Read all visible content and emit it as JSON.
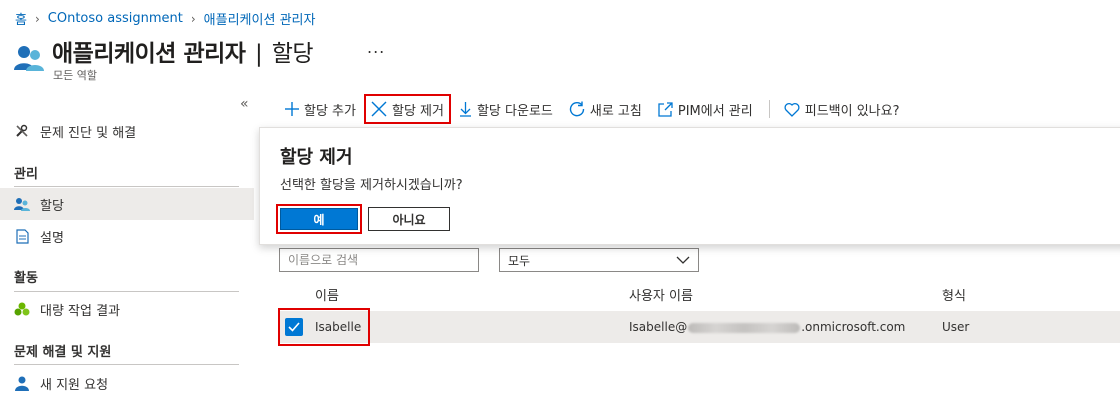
{
  "breadcrumb": {
    "home": "홈",
    "assignment": "COntoso assignment",
    "current": "애플리케이션 관리자"
  },
  "header": {
    "title": "애플리케이션 관리자",
    "separator": "|",
    "section": "할당",
    "more": "...",
    "subtitle": "모든 역할"
  },
  "sidebar": {
    "collapse": "«",
    "diagnose": "문제 진단 및 해결",
    "group_manage": "관리",
    "assignments": "할당",
    "description": "설명",
    "group_activity": "활동",
    "bulk_results": "대량 작업 결과",
    "group_support": "문제 해결 및 지원",
    "new_support": "새 지원 요청"
  },
  "toolbar": {
    "add": "할당 추가",
    "remove": "할당 제거",
    "download": "할당 다운로드",
    "refresh": "새로 고침",
    "pim": "PIM에서 관리",
    "feedback": "피드백이 있나요?"
  },
  "dialog": {
    "title": "할당 제거",
    "message": "선택한 할당을 제거하시겠습니까?",
    "yes": "예",
    "no": "아니요"
  },
  "filters": {
    "search_placeholder": "이름으로 검색",
    "select_value": "모두"
  },
  "table": {
    "columns": {
      "name": "이름",
      "user": "사용자 이름",
      "type": "형식"
    },
    "rows": [
      {
        "name": "Isabelle",
        "user_prefix": "Isabelle@",
        "user_suffix": ".onmicrosoft.com",
        "type": "User",
        "checked": true
      }
    ]
  },
  "colors": {
    "accent": "#0078d4",
    "highlight": "#e00000",
    "link": "#0067b8"
  }
}
